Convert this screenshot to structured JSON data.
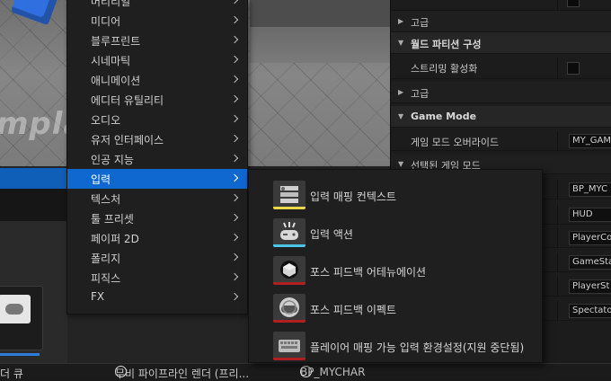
{
  "menu": {
    "items": [
      {
        "label": "머티리얼",
        "selected": false
      },
      {
        "label": "미디어",
        "selected": false
      },
      {
        "label": "블루프린트",
        "selected": false
      },
      {
        "label": "시네마틱",
        "selected": false
      },
      {
        "label": "애니메이션",
        "selected": false
      },
      {
        "label": "에디터 유틸리티",
        "selected": false
      },
      {
        "label": "오디오",
        "selected": false
      },
      {
        "label": "유저 인터페이스",
        "selected": false
      },
      {
        "label": "인공 지능",
        "selected": false
      },
      {
        "label": "입력",
        "selected": true
      },
      {
        "label": "텍스처",
        "selected": false
      },
      {
        "label": "툴 프리셋",
        "selected": false
      },
      {
        "label": "페이퍼 2D",
        "selected": false
      },
      {
        "label": "폴리지",
        "selected": false
      },
      {
        "label": "피직스",
        "selected": false
      },
      {
        "label": "FX",
        "selected": false
      }
    ]
  },
  "submenu": {
    "items": [
      {
        "label": "입력 매핑 컨텍스트",
        "icon": "input-mapping-context-icon",
        "accent": "#e8d84a"
      },
      {
        "label": "입력 액션",
        "icon": "input-action-icon",
        "accent": "#4cc6e6"
      },
      {
        "label": "포스 피드백 어테뉴에이션",
        "icon": "force-feedback-attenuation-icon",
        "accent": "#b02020"
      },
      {
        "label": "포스 피드백 이펙트",
        "icon": "force-feedback-effect-icon",
        "accent": "#b02020"
      },
      {
        "label": "플레이어 매핑 가능 입력 환경설정(지원 중단됨)",
        "icon": "player-mappable-input-config-icon",
        "accent": "#b02020"
      }
    ]
  },
  "viewport": {
    "overlay_text": "mpla"
  },
  "details": {
    "advanced_1": "고급",
    "world_partition_section": "월드 파티션 구성",
    "streaming_enabled_label": "스트리밍 활성화",
    "advanced_2": "고급",
    "game_mode_section": "Game Mode",
    "game_mode_override_label": "게임 모드 오버라이드",
    "game_mode_override_value": "MY_GAM",
    "selected_game_mode_label": "선택된 게임 모드",
    "values": [
      "BP_MYC",
      "HUD",
      "PlayerCo",
      "GameSta",
      "PlayerSt",
      "Spectato"
    ]
  },
  "bottom_bar": {
    "tab1": "더 큐",
    "tab2": "무비 파이프라인 렌더 (프리...",
    "tab3": "BP_MYCHAR"
  },
  "colors": {
    "selection": "#0f68d0",
    "accent_blue": "#2f6fe0"
  }
}
